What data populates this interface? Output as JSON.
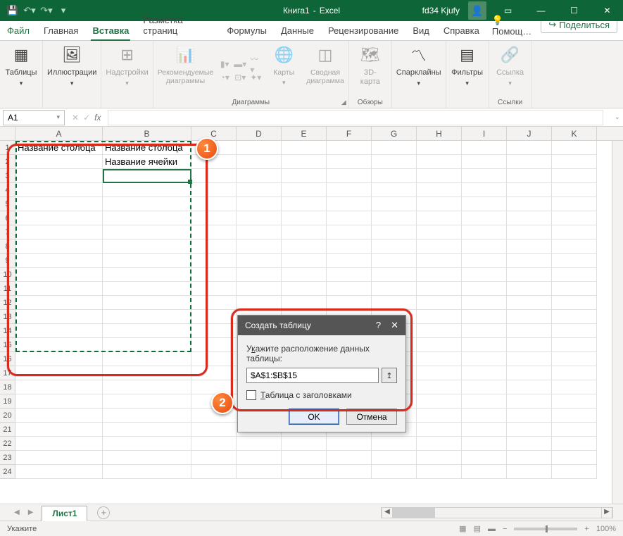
{
  "title": {
    "doc": "Книга1",
    "app": "Excel",
    "user": "fd34 Kjufy"
  },
  "tabs": [
    "Файл",
    "Главная",
    "Вставка",
    "Разметка страниц",
    "Формулы",
    "Данные",
    "Рецензирование",
    "Вид",
    "Справка"
  ],
  "help": "Помощ…",
  "share": "Поделиться",
  "ribbon": {
    "tables": "Таблицы",
    "illus": "Иллюстрации",
    "addins": "Надстройки",
    "recchart": "Рекомендуемые\nдиаграммы",
    "maps": "Карты",
    "pivot": "Сводная\nдиаграмма",
    "tours_grp": "Обзоры",
    "tours": "3D-\nкарта",
    "diag_grp": "Диаграммы",
    "spark": "Спарклайны",
    "filters": "Фильтры",
    "links": "Ссылка",
    "links_grp": "Ссылки"
  },
  "namebox": "A1",
  "cells": {
    "a1": "Название столбца",
    "b1": "Название столбца",
    "b2": "Название ячейки"
  },
  "columns": [
    "A",
    "B",
    "C",
    "D",
    "E",
    "F",
    "G",
    "H",
    "I",
    "J",
    "K"
  ],
  "dialog": {
    "title": "Создать таблицу",
    "label_pre": "У",
    "label_u": "к",
    "label_post": "ажите расположение данных таблицы:",
    "range": "$A$1:$B$15",
    "chk_u": "Т",
    "chk_post": "аблица с заголовками",
    "ok": "OK",
    "cancel": "Отмена"
  },
  "sheet": "Лист1",
  "status": "Укажите",
  "zoom": "100%"
}
